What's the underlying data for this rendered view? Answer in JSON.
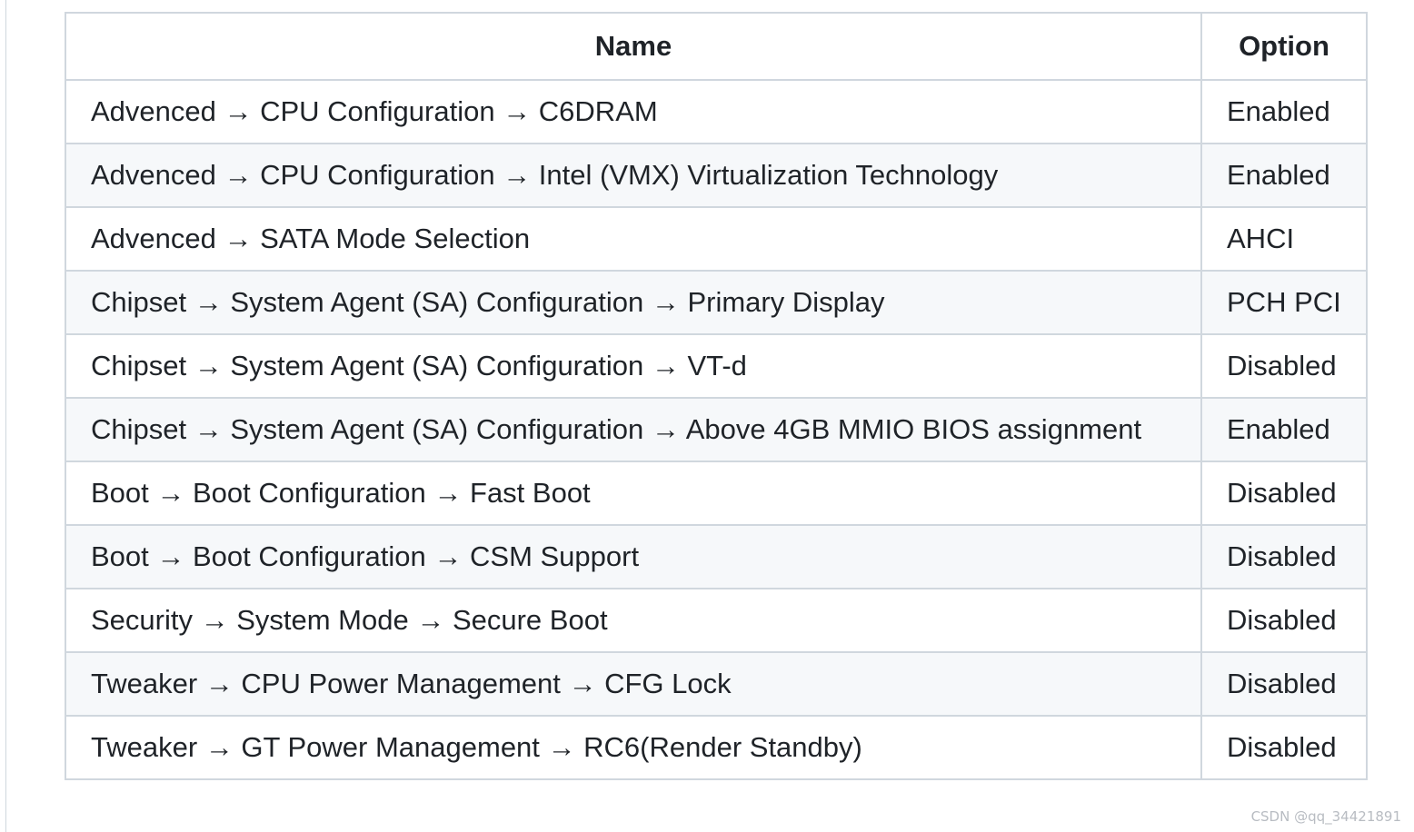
{
  "table": {
    "headers": {
      "name": "Name",
      "option": "Option"
    },
    "rows": [
      {
        "name": "Advenced → CPU Configuration → C6DRAM",
        "option": "Enabled"
      },
      {
        "name": "Advenced → CPU Configuration → Intel (VMX) Virtualization Technology",
        "option": "Enabled"
      },
      {
        "name": "Advenced → SATA Mode Selection",
        "option": "AHCI"
      },
      {
        "name": "Chipset → System Agent (SA) Configuration → Primary Display",
        "option": "PCH PCI"
      },
      {
        "name": "Chipset → System Agent (SA) Configuration → VT-d",
        "option": "Disabled"
      },
      {
        "name": "Chipset → System Agent (SA) Configuration → Above 4GB MMIO BIOS assignment",
        "option": "Enabled"
      },
      {
        "name": "Boot → Boot Configuration → Fast Boot",
        "option": "Disabled"
      },
      {
        "name": "Boot → Boot Configuration → CSM Support",
        "option": "Disabled"
      },
      {
        "name": "Security → System Mode → Secure Boot",
        "option": "Disabled"
      },
      {
        "name": "Tweaker → CPU Power Management → CFG Lock",
        "option": "Disabled"
      },
      {
        "name": "Tweaker → GT Power Management → RC6(Render Standby)",
        "option": "Disabled"
      }
    ]
  },
  "watermark": "CSDN @qq_34421891",
  "colors": {
    "border": "#d0d7de",
    "stripe": "#f6f8fa",
    "text": "#1f2328"
  }
}
